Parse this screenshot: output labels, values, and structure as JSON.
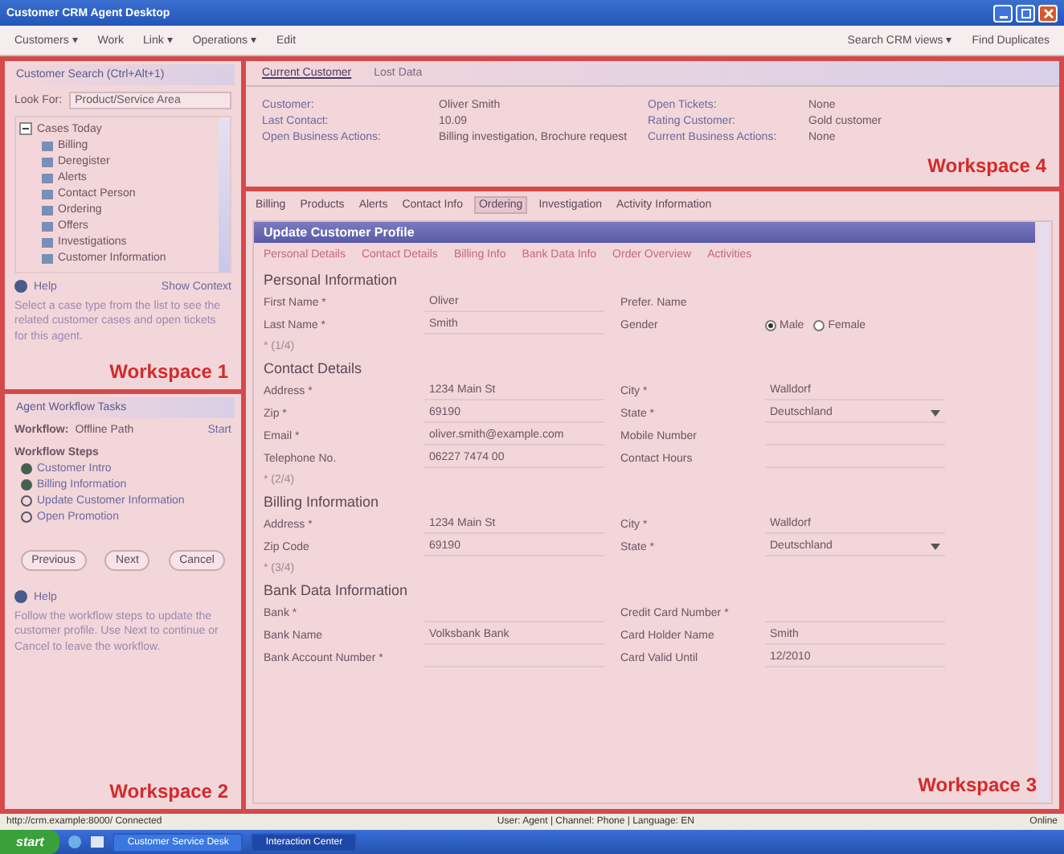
{
  "window": {
    "title": "Customer CRM Agent Desktop"
  },
  "toolbar": {
    "left": [
      {
        "label": "Customers ▾"
      },
      {
        "label": "Work"
      },
      {
        "label": "Link ▾"
      },
      {
        "label": "Operations ▾"
      },
      {
        "label": "Edit"
      }
    ],
    "right": [
      {
        "label": "Search CRM views ▾"
      },
      {
        "label": "Find Duplicates"
      }
    ]
  },
  "workspace1": {
    "header": "Customer Search (Ctrl+Alt+1)",
    "look_for_label": "Look For:",
    "look_for_value": "Product/Service Area",
    "tree": [
      {
        "label": "Cases Today",
        "expanded": true,
        "children": [
          {
            "label": "Billing"
          },
          {
            "label": "Deregister"
          },
          {
            "label": "Alerts"
          },
          {
            "label": "Contact Person"
          },
          {
            "label": "Ordering"
          },
          {
            "label": "Offers"
          },
          {
            "label": "Investigations"
          },
          {
            "label": "Customer Information"
          }
        ]
      }
    ],
    "help": "Help",
    "context_link": "Show Context",
    "description": "Select a case type from the list to see the related customer cases and open tickets for this agent.",
    "label": "Workspace 1"
  },
  "workspace2": {
    "header": "Agent Workflow Tasks",
    "workflow_label": "Workflow:",
    "workflow_value": "Offline Path",
    "action": "Start",
    "steps_title": "Workflow Steps",
    "steps": [
      {
        "label": "Customer Intro",
        "done": true
      },
      {
        "label": "Billing Information",
        "done": true
      },
      {
        "label": "Update Customer Information",
        "done": false
      },
      {
        "label": "Open Promotion",
        "done": false
      }
    ],
    "buttons": [
      "Previous",
      "Next",
      "Cancel"
    ],
    "help": "Help",
    "description": "Follow the workflow steps to update the customer profile. Use Next to continue or Cancel to leave the workflow.",
    "label": "Workspace 2"
  },
  "workspace4": {
    "tabs": [
      {
        "label": "Current Customer",
        "selected": true
      },
      {
        "label": "Lost Data",
        "selected": false
      }
    ],
    "info": [
      {
        "label": "Customer:",
        "value": "Oliver Smith"
      },
      {
        "label": "Open Tickets:",
        "value": "None"
      },
      {
        "label": "Last Contact:",
        "value": "10.09"
      },
      {
        "label": "Rating Customer:",
        "value": "Gold customer"
      },
      {
        "label": "Open Business Actions:",
        "value": "Billing investigation, Brochure request"
      },
      {
        "label": "Current Business Actions:",
        "value": "None"
      }
    ],
    "label": "Workspace 4"
  },
  "workspace3": {
    "tabs": [
      {
        "label": "Billing",
        "selected": false
      },
      {
        "label": "Products",
        "selected": false
      },
      {
        "label": "Alerts",
        "selected": false
      },
      {
        "label": "Contact Info",
        "selected": false
      },
      {
        "label": "Ordering",
        "selected": true
      },
      {
        "label": "Investigation",
        "selected": false
      },
      {
        "label": "Activity Information",
        "selected": false
      }
    ],
    "form_title": "Update Customer Profile",
    "links": [
      "Personal Details",
      "Contact Details",
      "Billing Info",
      "Bank Data Info",
      "Order Overview",
      "Activities"
    ],
    "sections": [
      {
        "title": "Personal Information",
        "rows": [
          {
            "left": {
              "label": "First Name *",
              "kind": "text",
              "value": "Oliver"
            },
            "right": {
              "label": "Prefer. Name",
              "kind": "none"
            }
          },
          {
            "left": {
              "label": "Last Name *",
              "kind": "text",
              "value": "Smith"
            },
            "right": {
              "label": "Gender",
              "kind": "radio",
              "options": [
                {
                  "label": "Male",
                  "selected": true
                },
                {
                  "label": "Female",
                  "selected": false
                }
              ]
            }
          }
        ],
        "note": "* (1/4)"
      },
      {
        "title": "Contact Details",
        "rows": [
          {
            "left": {
              "label": "Address *",
              "kind": "text",
              "value": "1234 Main St"
            },
            "right": {
              "label": "City *",
              "kind": "text",
              "value": "Walldorf"
            }
          },
          {
            "left": {
              "label": "Zip *",
              "kind": "text",
              "value": "69190"
            },
            "right": {
              "label": "State *",
              "kind": "select",
              "value": "Deutschland"
            }
          },
          {
            "left": {
              "label": "Email *",
              "kind": "text",
              "value": "oliver.smith@example.com"
            },
            "right": {
              "label": "Mobile Number",
              "kind": "text"
            }
          },
          {
            "left": {
              "label": "Telephone No.",
              "kind": "text",
              "value": "06227 7474 00"
            },
            "right": {
              "label": "Contact Hours",
              "kind": "text"
            }
          }
        ],
        "note": "* (2/4)"
      },
      {
        "title": "Billing Information",
        "rows": [
          {
            "left": {
              "label": "Address *",
              "kind": "text",
              "value": "1234 Main St"
            },
            "right": {
              "label": "City *",
              "kind": "text",
              "value": "Walldorf"
            }
          },
          {
            "left": {
              "label": "Zip Code",
              "kind": "text",
              "value": "69190"
            },
            "right": {
              "label": "State *",
              "kind": "select",
              "value": "Deutschland"
            }
          }
        ],
        "note": "* (3/4)"
      },
      {
        "title": "Bank Data Information",
        "rows": [
          {
            "left": {
              "label": "Bank *",
              "kind": "text"
            },
            "right": {
              "label": "Credit Card Number *",
              "kind": "text"
            }
          },
          {
            "left": {
              "label": "Bank Name",
              "kind": "text",
              "value": "Volksbank Bank"
            },
            "right": {
              "label": "Card Holder Name",
              "kind": "text",
              "value": "Smith"
            }
          },
          {
            "left": {
              "label": "Bank Account Number *",
              "kind": "text"
            },
            "right": {
              "label": "Card Valid Until",
              "kind": "text",
              "value": "12/2010"
            }
          }
        ]
      }
    ],
    "label": "Workspace 3"
  },
  "status_bar": {
    "left": "http://crm.example:8000/ Connected",
    "middle": "User: Agent | Channel: Phone | Language: EN",
    "right": "Online"
  },
  "taskbar": {
    "start": "start",
    "tasks": [
      {
        "label": "Customer Service Desk",
        "selected": false
      },
      {
        "label": "Interaction Center",
        "selected": true
      }
    ]
  }
}
